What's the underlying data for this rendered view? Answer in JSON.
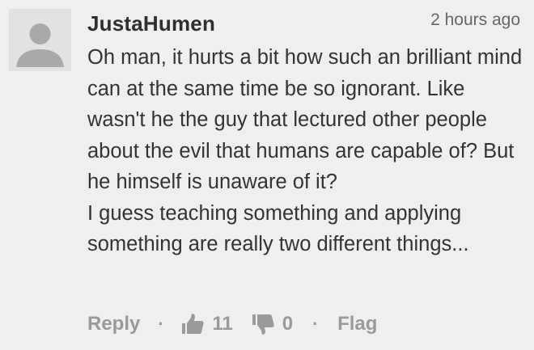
{
  "comment": {
    "author": "JustaHumen",
    "timestamp": "2 hours ago",
    "avatar_icon": "default-user-avatar",
    "paragraphs": [
      "Oh man, it hurts a bit how such an brilliant mind can at the same time be so ignorant. Like wasn't he the guy that lectured other people about the evil that humans are capable of? But he himself is unaware of it?",
      "I guess teaching something and applying something are really two different things..."
    ],
    "actions": {
      "reply_label": "Reply",
      "separator": "·",
      "upvote_icon": "thumbs-up-icon",
      "upvote_count": "11",
      "downvote_icon": "thumbs-down-icon",
      "downvote_count": "0",
      "flag_label": "Flag"
    }
  },
  "colors": {
    "background": "#efefef",
    "avatar_bg": "#e2e2e2",
    "avatar_fg": "#a9a9a9",
    "text": "#333333",
    "muted": "#9a9a9a"
  }
}
